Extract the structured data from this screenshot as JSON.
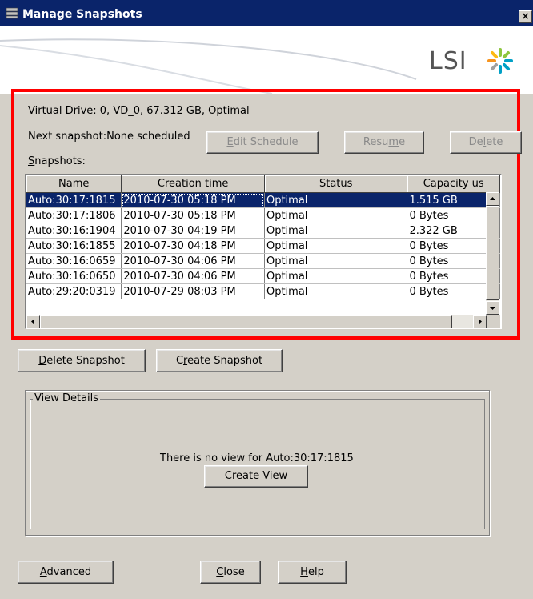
{
  "window": {
    "title": "Manage Snapshots",
    "close_glyph": "×",
    "logo_text": "LSI",
    "logo_icon": "lsi-starburst-icon"
  },
  "info": {
    "virtual_drive": "Virtual Drive: 0, VD_0, 67.312 GB, Optimal",
    "next_snapshot": "Next snapshot:None scheduled",
    "snapshots_label_prefix": "",
    "snapshots_label_ul": "S",
    "snapshots_label_rest": "napshots:"
  },
  "buttons": {
    "edit_schedule": {
      "ul": "E",
      "rest": "dit Schedule"
    },
    "resume": {
      "pre": "Resu",
      "ul": "m",
      "rest": "e"
    },
    "delete": {
      "pre": "De",
      "ul": "l",
      "rest": "ete"
    },
    "delete_snapshot": {
      "ul": "D",
      "rest": "elete Snapshot"
    },
    "create_snapshot": {
      "pre": "C",
      "ul": "r",
      "rest": "eate Snapshot"
    },
    "create_view": {
      "pre": "Crea",
      "ul": "t",
      "rest": "e View"
    },
    "advanced": {
      "ul": "A",
      "rest": "dvanced"
    },
    "close": {
      "ul": "C",
      "rest": "lose"
    },
    "help": {
      "ul": "H",
      "rest": "elp"
    }
  },
  "table": {
    "columns": [
      "Name",
      "Creation time",
      "Status",
      "Capacity us"
    ],
    "rows": [
      {
        "name": "Auto:30:17:1815",
        "time": "2010-07-30 05:18 PM",
        "status": "Optimal",
        "capacity": "1.515 GB",
        "selected": true
      },
      {
        "name": "Auto:30:17:1806",
        "time": "2010-07-30 05:18 PM",
        "status": "Optimal",
        "capacity": "0 Bytes"
      },
      {
        "name": "Auto:30:16:1904",
        "time": "2010-07-30 04:19 PM",
        "status": "Optimal",
        "capacity": "2.322 GB"
      },
      {
        "name": "Auto:30:16:1855",
        "time": "2010-07-30 04:18 PM",
        "status": "Optimal",
        "capacity": "0 Bytes"
      },
      {
        "name": "Auto:30:16:0659",
        "time": "2010-07-30 04:06 PM",
        "status": "Optimal",
        "capacity": "0 Bytes"
      },
      {
        "name": "Auto:30:16:0650",
        "time": "2010-07-30 04:06 PM",
        "status": "Optimal",
        "capacity": "0 Bytes"
      },
      {
        "name": "Auto:29:20:0319",
        "time": "2010-07-29 08:03 PM",
        "status": "Optimal",
        "capacity": "0 Bytes"
      }
    ]
  },
  "view_details": {
    "legend": "View Details",
    "message": "There is no view for Auto:30:17:1815"
  },
  "colors": {
    "selection": "#0a246a",
    "highlight_border": "#ff0000",
    "window_bg": "#d4d0c8"
  }
}
